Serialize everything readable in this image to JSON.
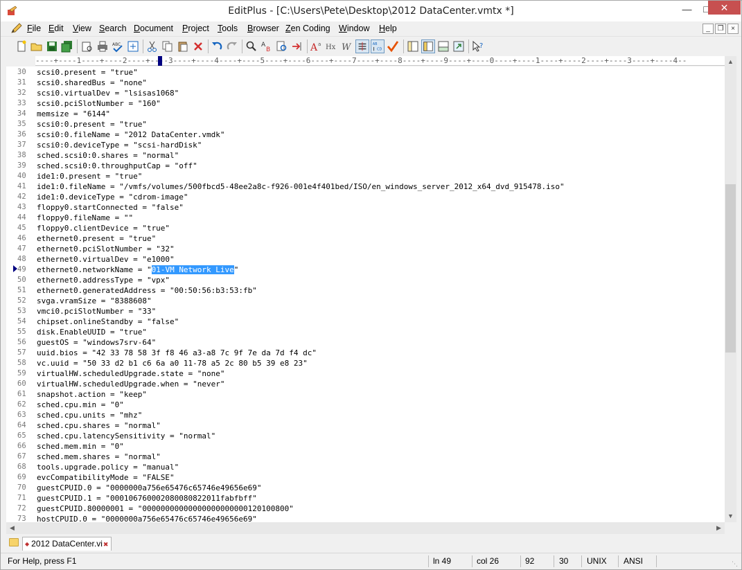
{
  "window": {
    "title": "EditPlus - [C:\\Users\\Pete\\Desktop\\2012 DataCenter.vmtx *]",
    "min_label": "—",
    "max_label": "□",
    "close_label": "✕"
  },
  "menu": {
    "items": [
      {
        "accel": "F",
        "rest": "ile"
      },
      {
        "accel": "E",
        "rest": "dit"
      },
      {
        "accel": "V",
        "rest": "iew"
      },
      {
        "accel": "S",
        "rest": "earch"
      },
      {
        "accel": "D",
        "rest": "ocument"
      },
      {
        "accel": "P",
        "rest": "roject"
      },
      {
        "accel": "T",
        "rest": "ools"
      },
      {
        "accel": "B",
        "rest": "rowser"
      },
      {
        "accel": "Z",
        "rest": "en Coding"
      },
      {
        "accel": "W",
        "rest": "indow"
      },
      {
        "accel": "H",
        "rest": "elp"
      }
    ],
    "mdi_min": "_",
    "mdi_restore": "❐",
    "mdi_close": "×"
  },
  "toolbar": {
    "icons": [
      "new-file-icon",
      "open-file-icon",
      "save-icon",
      "save-all-icon",
      "print-preview-icon",
      "print-icon",
      "spell-check-icon",
      "browser-preview-icon",
      "cut-icon",
      "copy-icon",
      "paste-icon",
      "delete-icon",
      "undo-icon",
      "redo-icon",
      "find-icon",
      "replace-icon",
      "find-in-files-icon",
      "goto-line-icon",
      "font-icon",
      "hex-viewer-icon",
      "word-wrap-icon",
      "ruler-icon",
      "line-number-icon",
      "spell-icon",
      "cliptext-icon",
      "directory-icon",
      "output-window-icon",
      "fullscreen-icon",
      "context-help-icon"
    ]
  },
  "ruler": {
    "text": "----+----1----+----2----+----3----+----4----+----5----+----6----+----7----+----8----+----9----+----0----+----1----+----2----+----3----+----4--"
  },
  "editor": {
    "lines": [
      {
        "num": "30",
        "text": "scsi0.present = \"true\""
      },
      {
        "num": "31",
        "text": "scsi0.sharedBus = \"none\""
      },
      {
        "num": "32",
        "text": "scsi0.virtualDev = \"lsisas1068\""
      },
      {
        "num": "33",
        "text": "scsi0.pciSlotNumber = \"160\""
      },
      {
        "num": "34",
        "text": "memsize = \"6144\""
      },
      {
        "num": "35",
        "text": "scsi0:0.present = \"true\""
      },
      {
        "num": "36",
        "text": "scsi0:0.fileName = \"2012 DataCenter.vmdk\""
      },
      {
        "num": "37",
        "text": "scsi0:0.deviceType = \"scsi-hardDisk\""
      },
      {
        "num": "38",
        "text": "sched.scsi0:0.shares = \"normal\""
      },
      {
        "num": "39",
        "text": "sched.scsi0:0.throughputCap = \"off\""
      },
      {
        "num": "40",
        "text": "ide1:0.present = \"true\""
      },
      {
        "num": "41",
        "text": "ide1:0.fileName = \"/vmfs/volumes/500fbcd5-48ee2a8c-f926-001e4f401bed/ISO/en_windows_server_2012_x64_dvd_915478.iso\""
      },
      {
        "num": "42",
        "text": "ide1:0.deviceType = \"cdrom-image\""
      },
      {
        "num": "43",
        "text": "floppy0.startConnected = \"false\""
      },
      {
        "num": "44",
        "text": "floppy0.fileName = \"\""
      },
      {
        "num": "45",
        "text": "floppy0.clientDevice = \"true\""
      },
      {
        "num": "46",
        "text": "ethernet0.present = \"true\""
      },
      {
        "num": "47",
        "text": "ethernet0.pciSlotNumber = \"32\""
      },
      {
        "num": "48",
        "text": "ethernet0.virtualDev = \"e1000\""
      },
      {
        "num": "49",
        "text": "ethernet0.networkName = \"",
        "selected": "01-VM Network Live",
        "after": "\""
      },
      {
        "num": "50",
        "text": "ethernet0.addressType = \"vpx\""
      },
      {
        "num": "51",
        "text": "ethernet0.generatedAddress = \"00:50:56:b3:53:fb\""
      },
      {
        "num": "52",
        "text": "svga.vramSize = \"8388608\""
      },
      {
        "num": "53",
        "text": "vmci0.pciSlotNumber = \"33\""
      },
      {
        "num": "54",
        "text": "chipset.onlineStandby = \"false\""
      },
      {
        "num": "55",
        "text": "disk.EnableUUID = \"true\""
      },
      {
        "num": "56",
        "text": "guestOS = \"windows7srv-64\""
      },
      {
        "num": "57",
        "text": "uuid.bios = \"42 33 78 58 3f f8 46 a3-a8 7c 9f 7e da 7d f4 dc\""
      },
      {
        "num": "58",
        "text": "vc.uuid = \"50 33 d2 b1 c6 6a a0 11-78 a5 2c 80 b5 39 e8 23\""
      },
      {
        "num": "59",
        "text": "virtualHW.scheduledUpgrade.state = \"none\""
      },
      {
        "num": "60",
        "text": "virtualHW.scheduledUpgrade.when = \"never\""
      },
      {
        "num": "61",
        "text": "snapshot.action = \"keep\""
      },
      {
        "num": "62",
        "text": "sched.cpu.min = \"0\""
      },
      {
        "num": "63",
        "text": "sched.cpu.units = \"mhz\""
      },
      {
        "num": "64",
        "text": "sched.cpu.shares = \"normal\""
      },
      {
        "num": "65",
        "text": "sched.cpu.latencySensitivity = \"normal\""
      },
      {
        "num": "66",
        "text": "sched.mem.min = \"0\""
      },
      {
        "num": "67",
        "text": "sched.mem.shares = \"normal\""
      },
      {
        "num": "68",
        "text": "tools.upgrade.policy = \"manual\""
      },
      {
        "num": "69",
        "text": "evcCompatibilityMode = \"FALSE\""
      },
      {
        "num": "70",
        "text": "guestCPUID.0 = \"0000000a756e65476c65746e49656e69\""
      },
      {
        "num": "71",
        "text": "guestCPUID.1 = \"000106760002080080822011fabfbff\""
      },
      {
        "num": "72",
        "text": "guestCPUID.80000001 = \"00000000000000000000000120100800\""
      },
      {
        "num": "73",
        "text": "hostCPUID.0 = \"0000000a756e65476c65746e49656e69\""
      }
    ]
  },
  "tabs": {
    "doc_tab_label": "2012 DataCenter.vi",
    "doc_icon": "◆",
    "close_icon": "✖"
  },
  "status": {
    "help": "For Help, press F1",
    "line": "ln 49",
    "col": "col 26",
    "total": "92",
    "chars": "30",
    "eol": "UNIX",
    "encoding": "ANSI"
  },
  "colors": {
    "selection": "#3399ff",
    "close_button": "#c75050",
    "current_line_marker": "#000080"
  }
}
